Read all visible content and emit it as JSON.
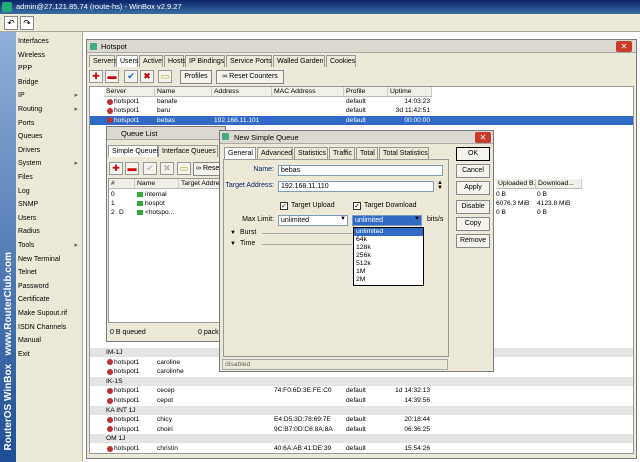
{
  "app": {
    "title": "admin@27.121.85.74 (route-hs) - WinBox v2.9.27",
    "undo": "↶",
    "redo": "↷",
    "brand": "RouterOS WinBox",
    "watermark": "www.RouterClub.com"
  },
  "sidebar": {
    "items": [
      {
        "label": "Interfaces",
        "sub": false
      },
      {
        "label": "Wireless",
        "sub": false
      },
      {
        "label": "PPP",
        "sub": false
      },
      {
        "label": "Bridge",
        "sub": false
      },
      {
        "label": "IP",
        "sub": true
      },
      {
        "label": "Routing",
        "sub": true
      },
      {
        "label": "Ports",
        "sub": false
      },
      {
        "label": "Queues",
        "sub": false
      },
      {
        "label": "Drivers",
        "sub": false
      },
      {
        "label": "System",
        "sub": true
      },
      {
        "label": "Files",
        "sub": false
      },
      {
        "label": "Log",
        "sub": false
      },
      {
        "label": "SNMP",
        "sub": false
      },
      {
        "label": "Users",
        "sub": false
      },
      {
        "label": "Radius",
        "sub": false
      },
      {
        "label": "Tools",
        "sub": true
      },
      {
        "label": "New Terminal",
        "sub": false
      },
      {
        "label": "Telnet",
        "sub": false
      },
      {
        "label": "Password",
        "sub": false
      },
      {
        "label": "Certificate",
        "sub": false
      },
      {
        "label": "Make Supout.rif",
        "sub": false
      },
      {
        "label": "ISDN Channels",
        "sub": false
      },
      {
        "label": "Manual",
        "sub": false
      },
      {
        "label": "Exit",
        "sub": false
      }
    ]
  },
  "hotspot": {
    "title": "Hotspot",
    "tabs": [
      "Servers",
      "Users",
      "Active",
      "Hosts",
      "IP Bindings",
      "Service Ports",
      "Walled Garden",
      "Cookies"
    ],
    "toolbar": {
      "profiles": "Profiles",
      "reset": "Reset Counters"
    },
    "columns": [
      "Server",
      "Name",
      "Address",
      "MAC Address",
      "Profile",
      "Uptime"
    ],
    "rows_top": [
      {
        "server": "hotspot1",
        "name": "banafe",
        "address": "",
        "mac": "",
        "profile": "default",
        "uptime": "14:03:23"
      },
      {
        "server": "hotspot1",
        "name": "baru",
        "address": "",
        "mac": "",
        "profile": "default",
        "uptime": "3d 11:42:51"
      },
      {
        "server": "hotspot1",
        "name": "bebas",
        "address": "192.168.11.101",
        "mac": "",
        "profile": "default",
        "uptime": "00:00:00"
      }
    ],
    "rows_bottom": [
      {
        "type": "group",
        "label": "IM-1J"
      },
      {
        "server": "hotspot1",
        "name": "caroline",
        "mac": "",
        "profile": "",
        "uptime": ""
      },
      {
        "server": "hotspot1",
        "name": "carolinhe",
        "mac": "",
        "profile": "",
        "uptime": ""
      },
      {
        "type": "group",
        "label": "IK-1S"
      },
      {
        "server": "hotspot1",
        "name": "cecep",
        "mac": "74:F0:6D:3E:FE:C0",
        "profile": "default",
        "uptime": "1d 14:32:13"
      },
      {
        "server": "hotspot1",
        "name": "cepot",
        "mac": "",
        "profile": "default",
        "uptime": "14:39:56"
      },
      {
        "type": "group",
        "label": "KA INT 1J"
      },
      {
        "server": "hotspot1",
        "name": "chicy",
        "mac": "E4:D5:3D:78:69:7E",
        "profile": "default",
        "uptime": "20:18:44"
      },
      {
        "server": "hotspot1",
        "name": "choiri",
        "mac": "9C:B7:0D:C6:8A:8A",
        "profile": "default",
        "uptime": "06:36:25"
      },
      {
        "type": "group",
        "label": "OM 1J"
      },
      {
        "server": "hotspot1",
        "name": "christin",
        "mac": "40:6A:AB:41:DE:39",
        "profile": "default",
        "uptime": "15:54:26"
      }
    ]
  },
  "queue_list": {
    "title": "Queue List",
    "tabs": [
      "Simple Queues",
      "Interface Queues"
    ],
    "reset": "Reset C",
    "columns": [
      "#",
      "Name",
      "Target Addre"
    ],
    "right_columns": [
      "Uploaded B...",
      "Download..."
    ],
    "rows": [
      {
        "num": "0",
        "flag": "",
        "name": "internal",
        "up": "0 B",
        "down": "0 B"
      },
      {
        "num": "1",
        "flag": "",
        "name": "hospot",
        "up": "6076.3 MiB",
        "down": "4123.8 MiB"
      },
      {
        "num": "2",
        "flag": "D",
        "name": "<hotspo...",
        "up": "0 B",
        "down": "0 B"
      }
    ],
    "status": "0 B queued",
    "status2": "0 packe"
  },
  "dialog": {
    "title": "New Simple Queue",
    "tabs": [
      "General",
      "Advanced",
      "Statistics",
      "Traffic",
      "Total",
      "Total Statistics"
    ],
    "name_label": "Name:",
    "name_value": "bebas",
    "target_label": "Target Address:",
    "target_value": "192.168.11.110",
    "target_upload": "Target Upload",
    "target_download": "Target Download",
    "max_limit_label": "Max Limit:",
    "upload_value": "unlimited",
    "download_value": "unlimited",
    "unit": "bits/s",
    "burst": "Burst",
    "time": "Time",
    "options": [
      "unlimited",
      "64k",
      "128k",
      "256k",
      "512k",
      "1M",
      "2M"
    ],
    "status": "disabled",
    "buttons": [
      "OK",
      "Cancel",
      "Apply",
      "Disable",
      "Copy",
      "Remove"
    ],
    "check": "✓"
  }
}
